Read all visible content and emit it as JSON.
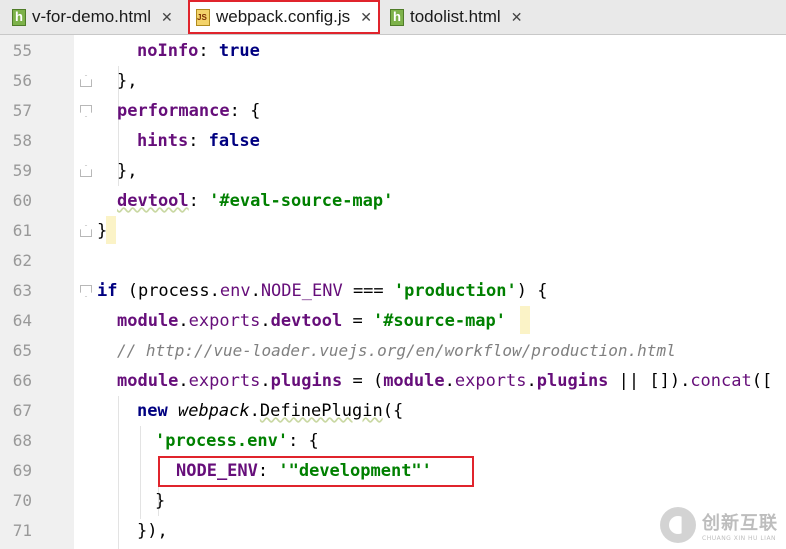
{
  "tabs": [
    {
      "label": "v-for-demo.html",
      "type": "html",
      "active": false
    },
    {
      "label": "webpack.config.js",
      "type": "js",
      "active": true
    },
    {
      "label": "todolist.html",
      "type": "html",
      "active": false
    }
  ],
  "line_numbers": [
    "55",
    "56",
    "57",
    "58",
    "59",
    "60",
    "61",
    "62",
    "63",
    "64",
    "65",
    "66",
    "67",
    "68",
    "69",
    "70",
    "71"
  ],
  "code": {
    "l55": {
      "key": "noInfo",
      "sep": ": ",
      "val": "true"
    },
    "l56": "},",
    "l57": {
      "key": "performance",
      "rest": ": {"
    },
    "l58": {
      "key": "hints",
      "sep": ": ",
      "val": "false"
    },
    "l59": "},",
    "l60": {
      "key": "devtool",
      "sep": ": ",
      "val": "'#eval-source-map'"
    },
    "l61": "}",
    "l63": {
      "kw": "if",
      "a": " (process.",
      "b": "env",
      "c": ".",
      "d": "NODE_ENV",
      "e": " === ",
      "str": "'production'",
      "f": ") {"
    },
    "l64": {
      "obj": "module",
      "dot1": ".",
      "exp": "exports",
      "dot2": ".",
      "prop": "devtool",
      "eq": " = ",
      "str": "'#source-map'"
    },
    "l65": "// http://vue-loader.vuejs.org/en/workflow/production.html",
    "l66": {
      "obj": "module",
      "dot1": ".",
      "exp": "exports",
      "dot2": ".",
      "prop": "plugins",
      "eq": " = (",
      "obj2": "module",
      "dot3": ".",
      "exp2": "exports",
      "dot4": ".",
      "prop2": "plugins",
      "rest": " || []).",
      "fn": "concat",
      "tail": "(["
    },
    "l67": {
      "kw": "new",
      "sp": " ",
      "cls": "webpack",
      "dot": ".",
      "fn": "DefinePlugin",
      "rest": "({"
    },
    "l68": {
      "str": "'process.env'",
      "rest": ": {"
    },
    "l69": {
      "key": "NODE_ENV",
      "sep": ": ",
      "str": "'\"development\"'"
    },
    "l70": "}",
    "l71": "}),"
  },
  "watermark": {
    "cn": "创新互联",
    "en": "CHUANG XIN HU LIAN"
  }
}
